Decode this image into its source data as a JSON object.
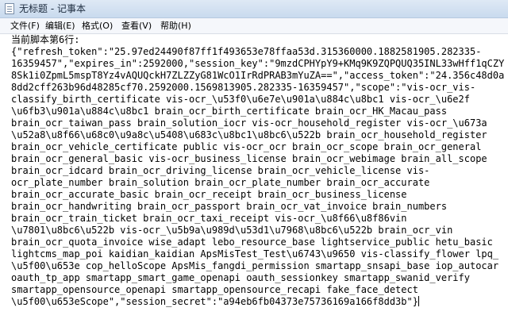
{
  "window": {
    "title": "无标题 - 记事本",
    "icon": "notepad-icon"
  },
  "menu": {
    "items": [
      {
        "label": "文件(F)"
      },
      {
        "label": "编辑(E)"
      },
      {
        "label": "格式(O)"
      },
      {
        "label": "查看(V)"
      },
      {
        "label": "帮助(H)"
      }
    ]
  },
  "editor": {
    "lines": [
      "当前脚本第6行:",
      "{\"refresh_token\":\"25.97ed24490f87ff1f493653e78ffaa53d.315360000.1882581905.282335-",
      "16359457\",\"expires_in\":2592000,\"session_key\":\"9mzdCPHYpY9+KMq9K9ZQPQUQ35INL33wHff1qCZY",
      "8Sk1i0ZpmL5mspT8Yz4vAQUQckH7ZLZZyG81WcO1IrRdPRAB3mYuZA==\",\"access_token\":\"24.356c48d0a",
      "8dd2cff263b96d48285cf70.2592000.1569813905.282335-16359457\",\"scope\":\"vis-ocr_vis-",
      "classify_birth_certificate vis-ocr_\\u53f0\\u6e7e\\u901a\\u884c\\u8bc1 vis-ocr_\\u6e2f",
      "\\u6fb3\\u901a\\u884c\\u8bc1 brain_ocr_birth_certificate brain_ocr_HK_Macau_pass",
      "brain_ocr_taiwan_pass brain_solution_iocr vis-ocr_household_register vis-ocr_\\u673a",
      "\\u52a8\\u8f66\\u68c0\\u9a8c\\u5408\\u683c\\u8bc1\\u8bc6\\u522b brain_ocr_household_register",
      "brain_ocr_vehicle_certificate public vis-ocr_ocr brain_ocr_scope brain_ocr_general",
      "brain_ocr_general_basic vis-ocr_business_license brain_ocr_webimage brain_all_scope",
      "brain_ocr_idcard brain_ocr_driving_license brain_ocr_vehicle_license vis-",
      "ocr_plate_number brain_solution brain_ocr_plate_number brain_ocr_accurate",
      "brain_ocr_accurate_basic brain_ocr_receipt brain_ocr_business_license",
      "brain_ocr_handwriting brain_ocr_passport brain_ocr_vat_invoice brain_numbers",
      "brain_ocr_train_ticket brain_ocr_taxi_receipt vis-ocr_\\u8f66\\u8f86vin",
      "\\u7801\\u8bc6\\u522b vis-ocr_\\u5b9a\\u989d\\u53d1\\u7968\\u8bc6\\u522b brain_ocr_vin",
      "brain_ocr_quota_invoice wise_adapt lebo_resource_base lightservice_public hetu_basic",
      "lightcms_map_poi kaidian_kaidian ApsMisTest_Test\\u6743\\u9650 vis-classify_flower lpq_",
      "\\u5f00\\u653e cop_helloScope ApsMis_fangdi_permission smartapp_snsapi_base iop_autocar",
      "oauth_tp_app smartapp_smart_game_openapi oauth_sessionkey smartapp_swanid_verify",
      "smartapp_opensource_openapi smartapp_opensource_recapi fake_face_detect",
      "\\u5f00\\u653eScope\",\"session_secret\":\"a94eb6fb04373e75736169a166f8dd3b\"}"
    ]
  }
}
